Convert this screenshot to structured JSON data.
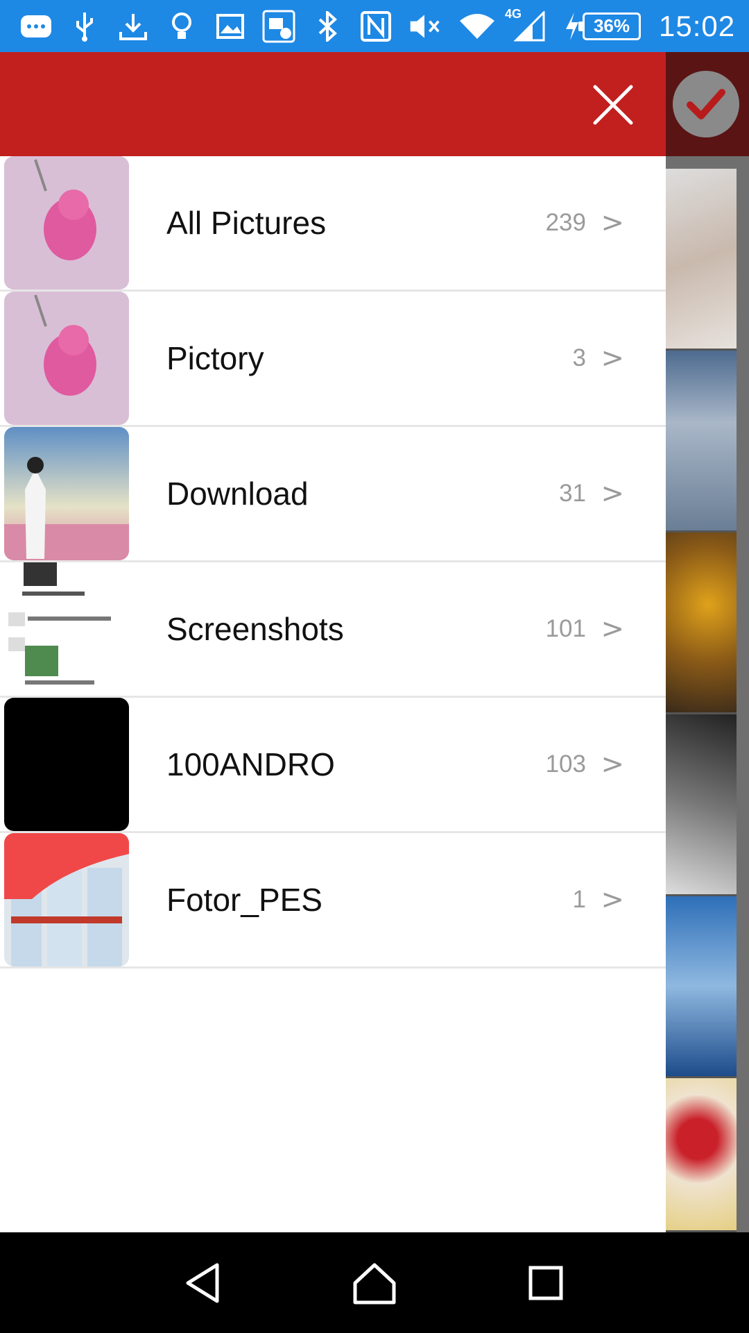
{
  "status_bar": {
    "battery": "36%",
    "time": "15:02",
    "network": "4G",
    "icons": [
      "message-icon",
      "usb-icon",
      "download-icon",
      "bulb-icon",
      "image-icon",
      "photo-check-icon",
      "bluetooth-icon",
      "nfc-icon",
      "mute-icon",
      "wifi-icon",
      "signal-icon",
      "charging-icon"
    ]
  },
  "drawer": {
    "close_icon": "close-icon",
    "albums": [
      {
        "name": "All Pictures",
        "count": "239",
        "chevron": ">"
      },
      {
        "name": "Pictory",
        "count": "3",
        "chevron": ">"
      },
      {
        "name": "Download",
        "count": "31",
        "chevron": ">"
      },
      {
        "name": "Screenshots",
        "count": "101",
        "chevron": ">"
      },
      {
        "name": "100ANDRO",
        "count": "103",
        "chevron": ">"
      },
      {
        "name": "Fotor_PES",
        "count": "1",
        "chevron": ">"
      }
    ]
  },
  "background": {
    "confirm_icon": "check-icon"
  },
  "nav_bar": {
    "icons": [
      "back-icon",
      "home-icon",
      "recents-icon"
    ]
  },
  "colors": {
    "status_bar": "#1e88e5",
    "header": "#c21f1f",
    "overlay_header": "#5a1414"
  }
}
